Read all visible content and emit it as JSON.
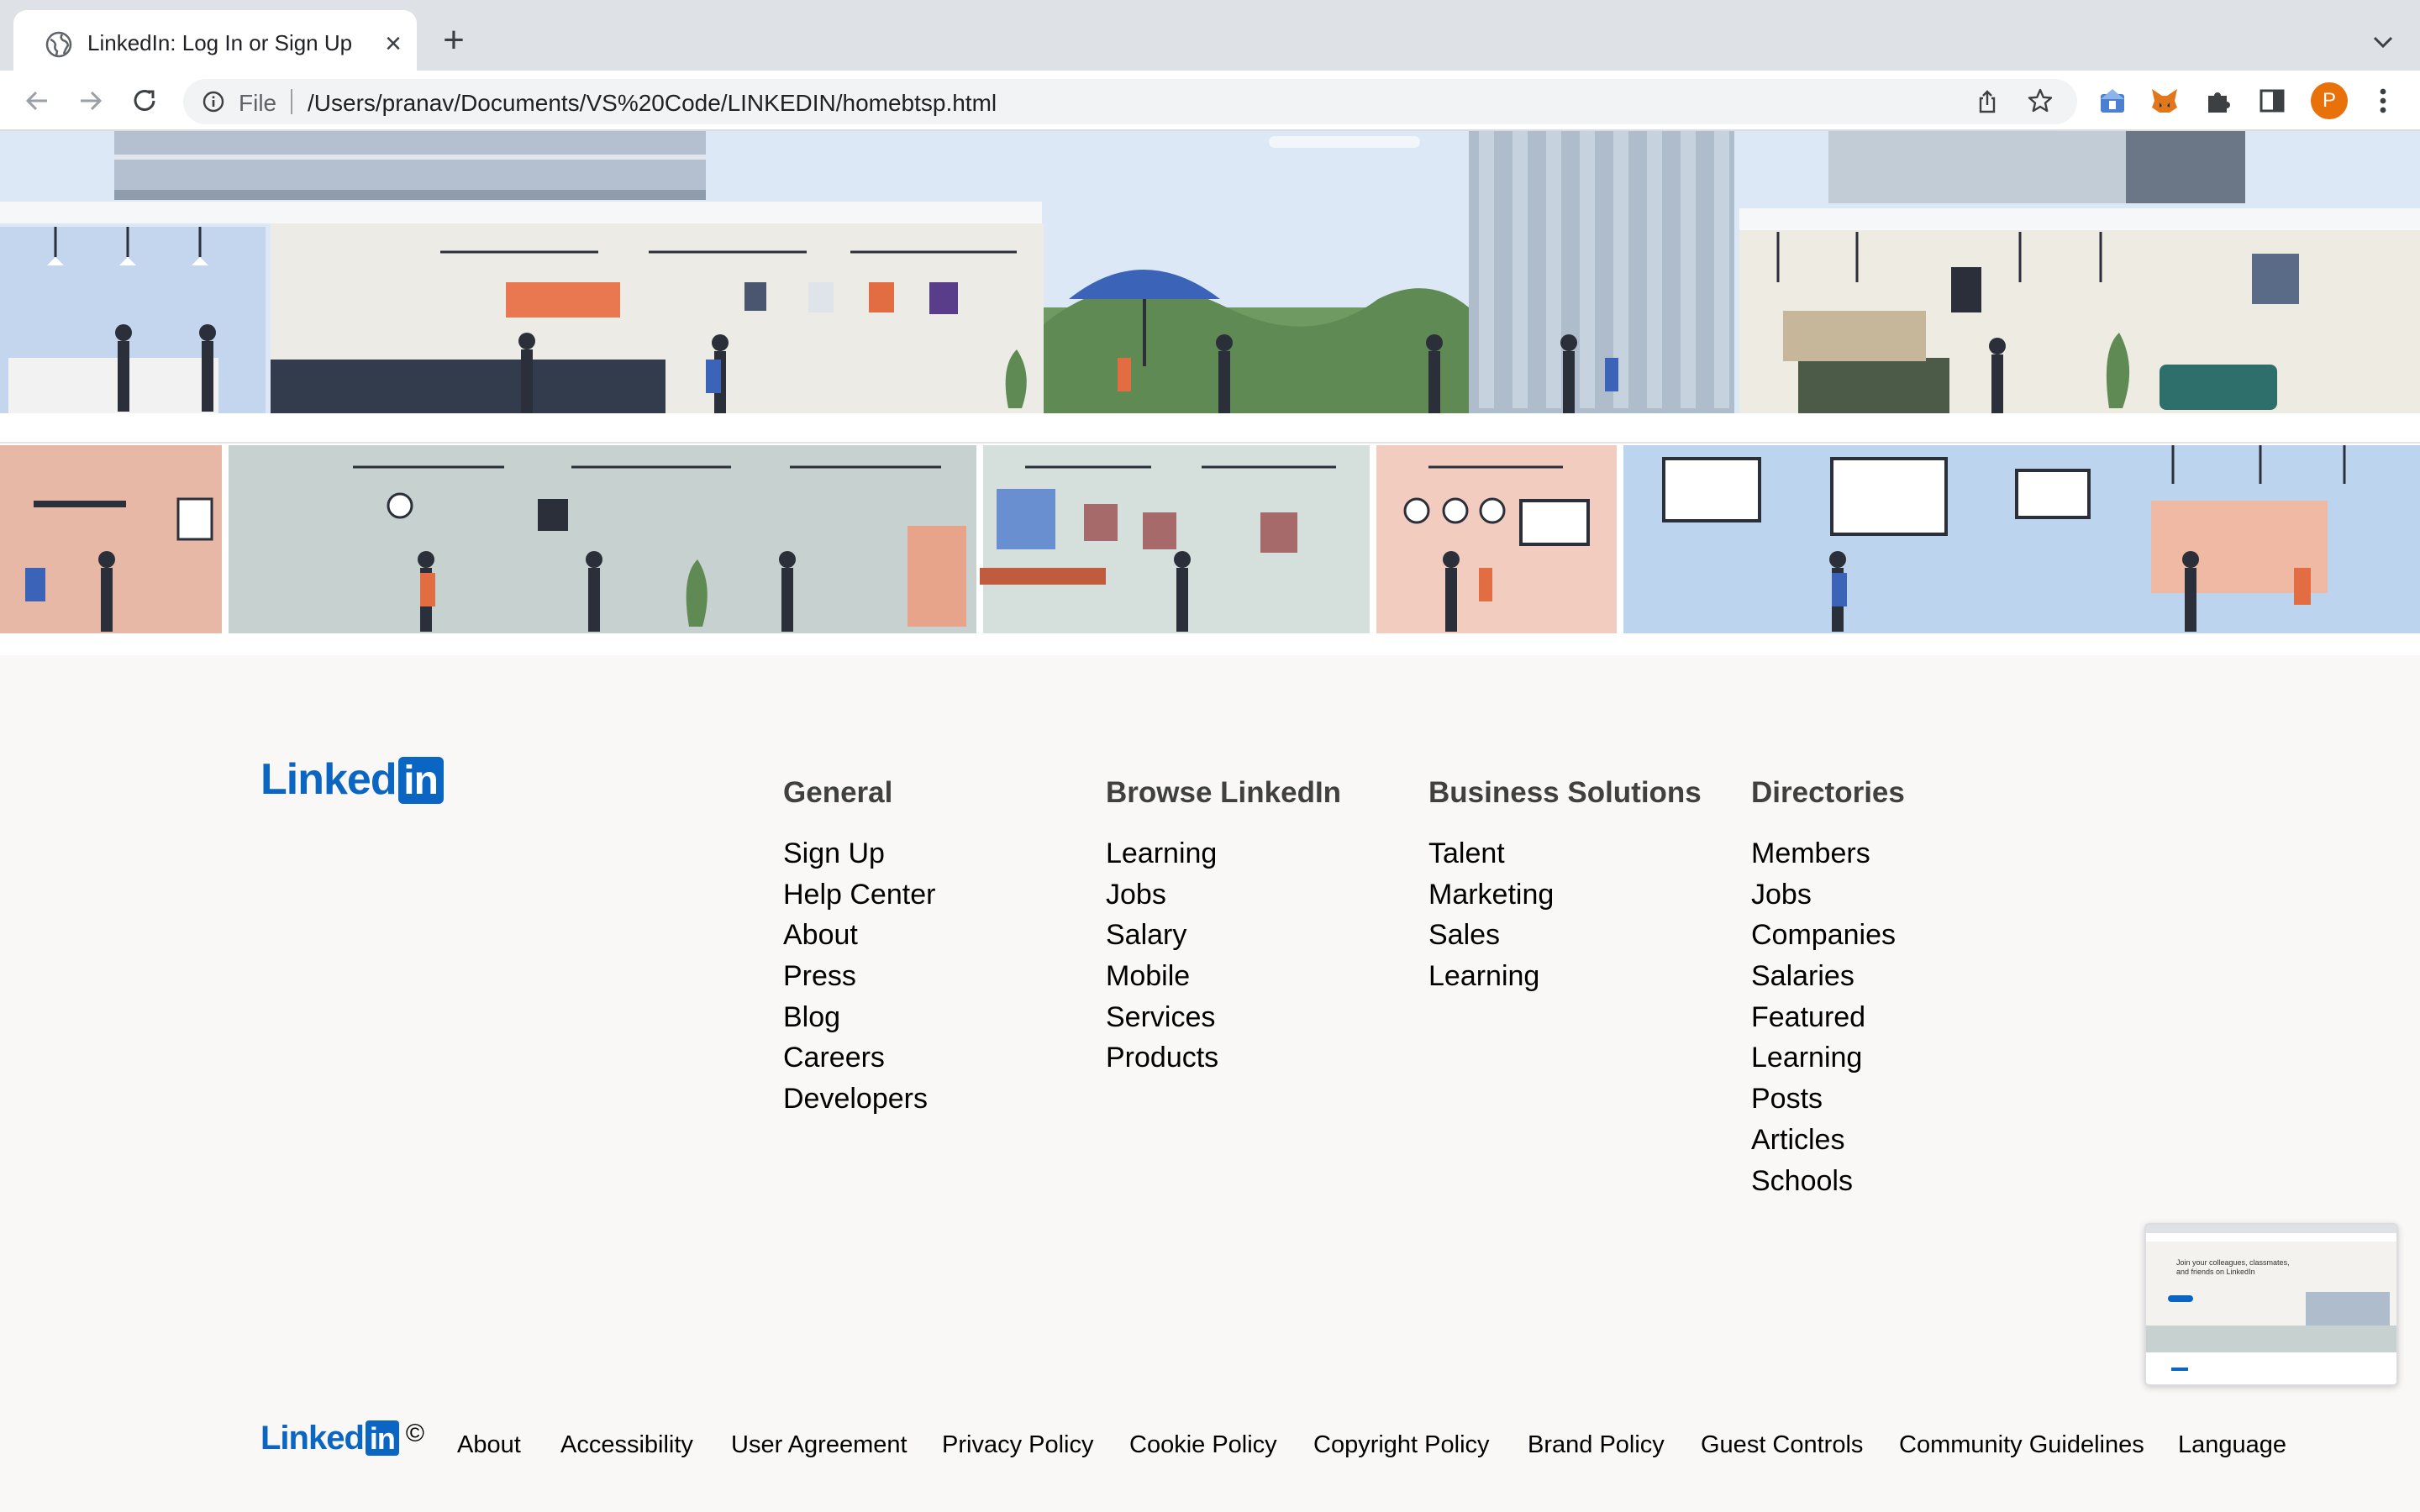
{
  "browser": {
    "tab_title": "LinkedIn: Log In or Sign Up",
    "new_tab_icon": "plus-icon",
    "scheme_label": "File",
    "url": "/Users/pranav/Documents/VS%20Code/LINKEDIN/homebtsp.html",
    "profile_initial": "P",
    "colors": {
      "tabstrip": "#dee1e6",
      "avatar": "#e8710a"
    }
  },
  "brand": {
    "logo_text": "Linked",
    "logo_in": "in",
    "copyright": "©",
    "color": "#0a66c2"
  },
  "footer": {
    "columns": [
      {
        "heading": "General",
        "links": [
          "Sign Up",
          "Help Center",
          "About",
          "Press",
          "Blog",
          "Careers",
          "Developers"
        ]
      },
      {
        "heading": "Browse LinkedIn",
        "links": [
          "Learning",
          "Jobs",
          "Salary",
          "Mobile",
          "Services",
          "Products"
        ]
      },
      {
        "heading": "Business Solutions",
        "links": [
          "Talent",
          "Marketing",
          "Sales",
          "Learning"
        ]
      },
      {
        "heading": "Directories",
        "links": [
          "Members",
          "Jobs",
          "Companies",
          "Salaries",
          "Featured",
          "Learning",
          "Posts",
          "Articles",
          "Schools"
        ]
      }
    ],
    "bottom_links": [
      "About",
      "Accessibility",
      "User Agreement",
      "Privacy Policy",
      "Cookie Policy",
      "Copyright Policy",
      "Brand Policy",
      "Guest Controls",
      "Community Guidelines",
      "Language"
    ]
  },
  "thumbnail": {
    "headline": "Join your colleagues, classmates, and friends on LinkedIn"
  }
}
